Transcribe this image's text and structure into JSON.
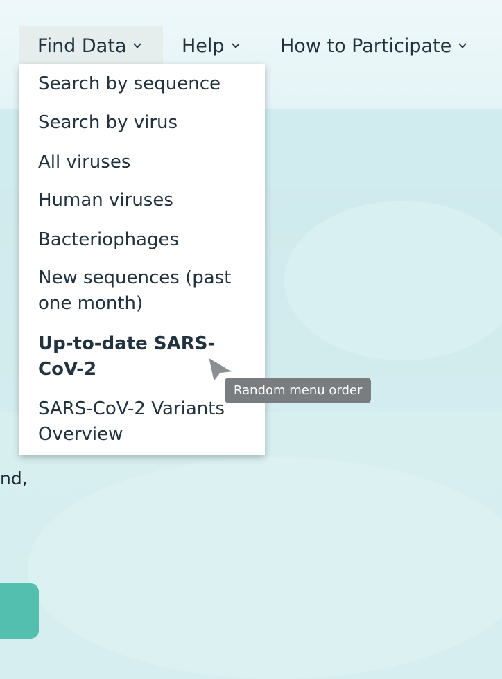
{
  "nav": {
    "items": [
      {
        "label": "Find Data",
        "icon": "chevron-down-icon"
      },
      {
        "label": "Help",
        "icon": "chevron-down-icon"
      },
      {
        "label": "How to Participate",
        "icon": "chevron-down-icon"
      }
    ]
  },
  "dropdown": {
    "items": [
      {
        "label": "Search by sequence"
      },
      {
        "label": "Search by virus"
      },
      {
        "label": "All viruses"
      },
      {
        "label": "Human viruses"
      },
      {
        "label": "Bacteriophages"
      },
      {
        "label": "New sequences (past one month)"
      },
      {
        "label": "Up-to-date SARS-CoV-2",
        "emphasis": "bold"
      },
      {
        "label": "SARS-CoV-2 Variants Overview"
      }
    ]
  },
  "tooltip": {
    "text": "Random menu order"
  },
  "page": {
    "body_fragment": "nd,"
  },
  "colors": {
    "accent_button": "#53bfae",
    "tooltip_bg": "#7a7d80",
    "nav_active_bg": "#e6eded"
  }
}
